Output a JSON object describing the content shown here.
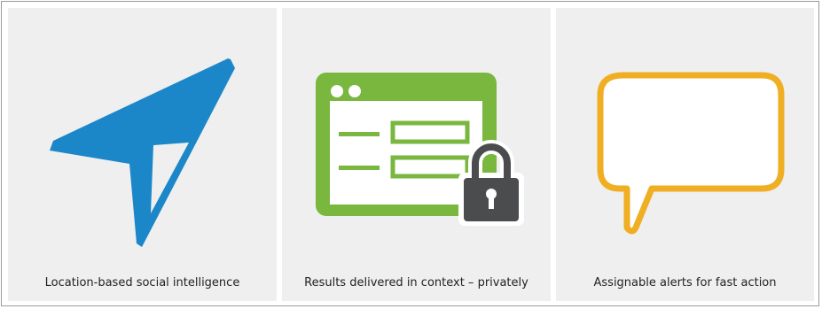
{
  "features": [
    {
      "icon": "location-arrow-icon",
      "color": "#1b87c9",
      "caption": "Location-based social intelligence"
    },
    {
      "icon": "private-browser-window-icon",
      "color": "#79b73f",
      "lock_color": "#4a4c4d",
      "caption": "Results delivered in context – privately"
    },
    {
      "icon": "speech-bubble-icon",
      "color": "#f0ae23",
      "caption": "Assignable alerts for fast action"
    }
  ]
}
